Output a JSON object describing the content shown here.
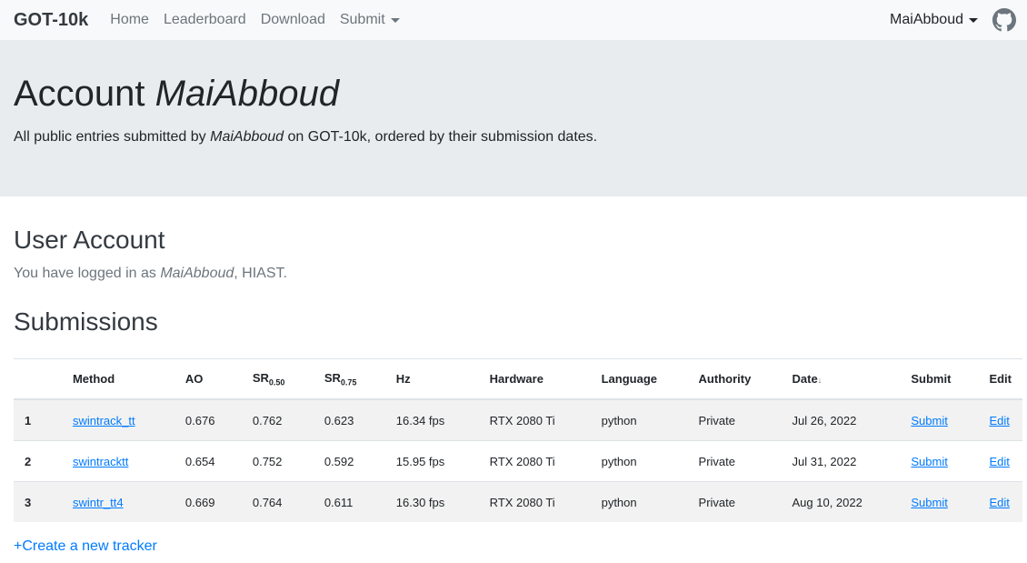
{
  "nav": {
    "brand": "GOT-10k",
    "links": [
      "Home",
      "Leaderboard",
      "Download",
      "Submit"
    ],
    "user": "MaiAbboud"
  },
  "jumbotron": {
    "title_prefix": "Account ",
    "title_user": "MaiAbboud",
    "desc_prefix": "All public entries submitted by ",
    "desc_user": "MaiAbboud",
    "desc_suffix": " on GOT-10k, ordered by their submission dates."
  },
  "account": {
    "heading": "User Account",
    "login_prefix": "You have logged in as ",
    "login_user": "MaiAbboud",
    "login_suffix": ", HIAST."
  },
  "submissions": {
    "heading": "Submissions",
    "columns": {
      "method": "Method",
      "ao": "AO",
      "sr": "SR",
      "sr050_sub": "0.50",
      "sr075_sub": "0.75",
      "hz": "Hz",
      "hardware": "Hardware",
      "language": "Language",
      "authority": "Authority",
      "date": "Date",
      "date_arrow": "↓",
      "submit": "Submit",
      "edit": "Edit"
    },
    "rows": [
      {
        "idx": "1",
        "method": "swintrack_tt",
        "ao": "0.676",
        "sr050": "0.762",
        "sr075": "0.623",
        "hz": "16.34 fps",
        "hardware": "RTX 2080 Ti",
        "language": "python",
        "authority": "Private",
        "date": "Jul 26, 2022",
        "submit": "Submit",
        "edit": "Edit"
      },
      {
        "idx": "2",
        "method": "swintracktt",
        "ao": "0.654",
        "sr050": "0.752",
        "sr075": "0.592",
        "hz": "15.95 fps",
        "hardware": "RTX 2080 Ti",
        "language": "python",
        "authority": "Private",
        "date": "Jul 31, 2022",
        "submit": "Submit",
        "edit": "Edit"
      },
      {
        "idx": "3",
        "method": "swintr_tt4",
        "ao": "0.669",
        "sr050": "0.764",
        "sr075": "0.611",
        "hz": "16.30 fps",
        "hardware": "RTX 2080 Ti",
        "language": "python",
        "authority": "Private",
        "date": "Aug 10, 2022",
        "submit": "Submit",
        "edit": "Edit"
      }
    ],
    "create_link": "+Create a new tracker"
  }
}
